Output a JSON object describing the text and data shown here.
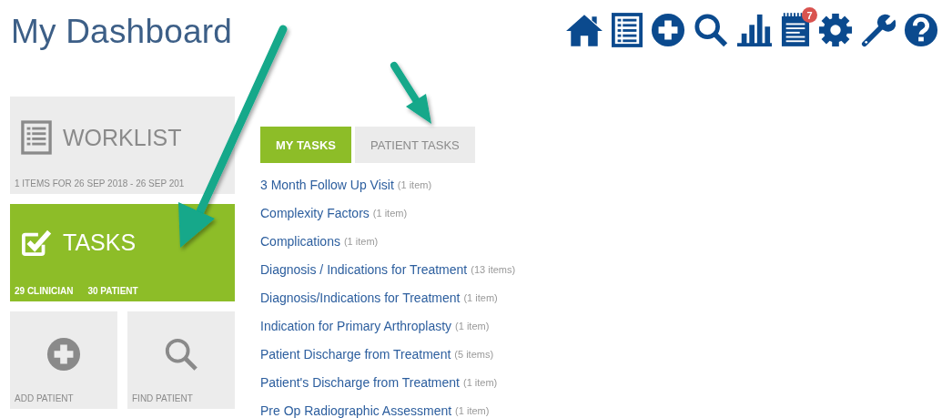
{
  "title": "My Dashboard",
  "toolbar": [
    {
      "kind": "home"
    },
    {
      "kind": "list"
    },
    {
      "kind": "add"
    },
    {
      "kind": "search"
    },
    {
      "kind": "chart"
    },
    {
      "kind": "notes",
      "badge": "7"
    },
    {
      "kind": "settings"
    },
    {
      "kind": "wrench"
    },
    {
      "kind": "help"
    }
  ],
  "tiles": [
    {
      "kind": "worklist",
      "label": "WORKLIST",
      "subtitle": "1 ITEMS FOR 26 SEP 2018 - 26 SEP 201",
      "selected": false
    },
    {
      "kind": "tasks",
      "label": "TASKS",
      "counts": [
        "29 CLINICIAN",
        "30 PATIENT"
      ],
      "selected": true
    },
    {
      "kind": "add",
      "label": "ADD PATIENT",
      "selected": false
    },
    {
      "kind": "find",
      "label": "FIND PATIENT",
      "selected": false
    }
  ],
  "tabs": [
    {
      "label": "MY TASKS",
      "selected": true
    },
    {
      "label": "PATIENT TASKS",
      "selected": false
    }
  ],
  "tasks": [
    {
      "name": "3 Month Follow Up Visit",
      "count": "(1 item)"
    },
    {
      "name": "Complexity Factors",
      "count": "(1 item)"
    },
    {
      "name": "Complications",
      "count": "(1 item)"
    },
    {
      "name": "Diagnosis / Indications for Treatment",
      "count": "(13 items)"
    },
    {
      "name": "Diagnosis/Indications for Treatment",
      "count": "(1 item)"
    },
    {
      "name": "Indication for Primary Arthroplasty",
      "count": "(1 item)"
    },
    {
      "name": "Patient Discharge from Treatment",
      "count": "(5 items)"
    },
    {
      "name": "Patient's Discharge from Treatment",
      "count": "(1 item)"
    },
    {
      "name": "Pre Op Radiographic Assessment",
      "count": "(1 item)"
    }
  ]
}
